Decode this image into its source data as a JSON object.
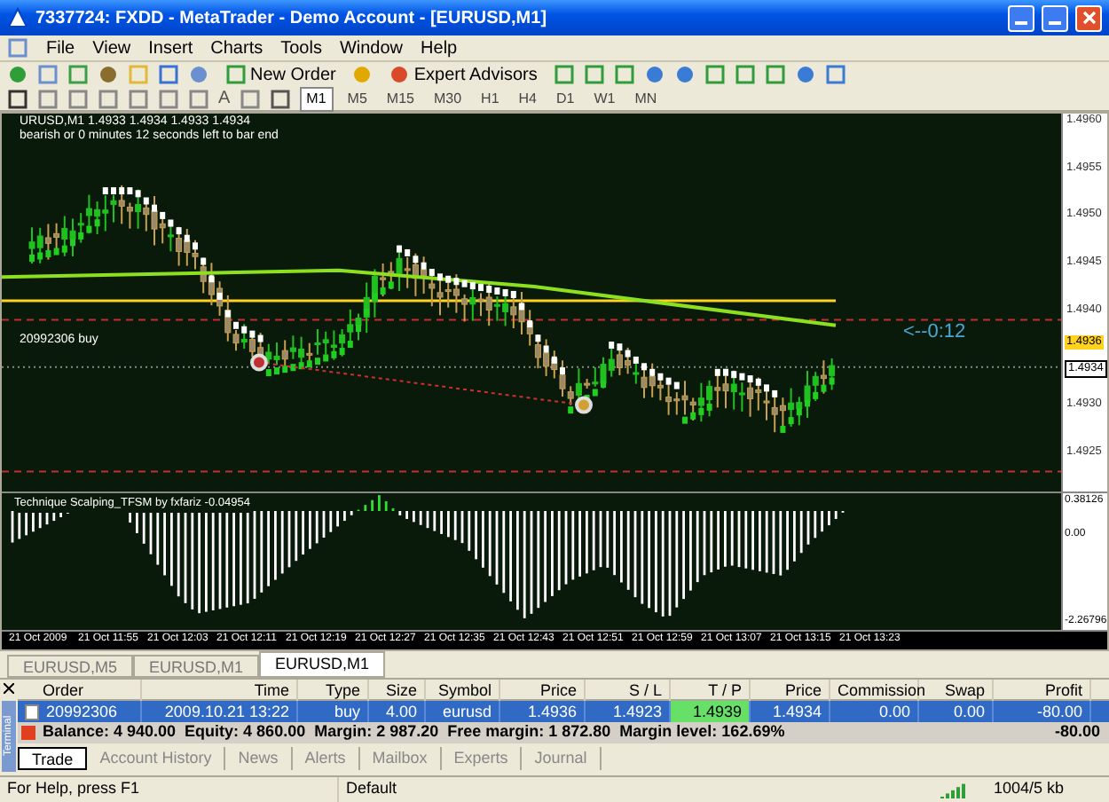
{
  "window": {
    "title": "7337724: FXDD - MetaTrader - Demo Account - [EURUSD,M1]"
  },
  "menu": [
    "File",
    "View",
    "Insert",
    "Charts",
    "Tools",
    "Window",
    "Help"
  ],
  "toolbar": {
    "new_order": "New Order",
    "expert_advisors": "Expert Advisors",
    "text_tool": "A"
  },
  "timeframes": [
    {
      "label": "M1",
      "selected": true
    },
    {
      "label": "M5",
      "selected": false
    },
    {
      "label": "M15",
      "selected": false
    },
    {
      "label": "M30",
      "selected": false
    },
    {
      "label": "H1",
      "selected": false
    },
    {
      "label": "H4",
      "selected": false
    },
    {
      "label": "D1",
      "selected": false
    },
    {
      "label": "W1",
      "selected": false
    },
    {
      "label": "MN",
      "selected": false
    }
  ],
  "chart": {
    "header": "URUSD,M1  1.4933 1.4934 1.4933 1.4934",
    "info": "bearish or 0 minutes 12 seconds left to bar end",
    "order_label": "20992306 buy",
    "countdown": "<--0:12",
    "price_axis": [
      {
        "label": "1.4960",
        "kind": "plain"
      },
      {
        "label": "1.4955",
        "kind": "plain"
      },
      {
        "label": "1.4950",
        "kind": "plain"
      },
      {
        "label": "1.4945",
        "kind": "plain"
      },
      {
        "label": "1.4940",
        "kind": "plain"
      },
      {
        "label": "1.4936",
        "kind": "ask"
      },
      {
        "label": "1.4934",
        "kind": "bid"
      },
      {
        "label": "1.4930",
        "kind": "plain"
      },
      {
        "label": "1.4925",
        "kind": "plain"
      }
    ],
    "indicator": {
      "title": "Technique Scalping_TFSM by fxfariz -0.04954",
      "axis": [
        "0.38126",
        "0.00",
        "-2.26796"
      ]
    },
    "time_axis": [
      "21 Oct 2009",
      "21 Oct 11:55",
      "21 Oct 12:03",
      "21 Oct 12:11",
      "21 Oct 12:19",
      "21 Oct 12:27",
      "21 Oct 12:35",
      "21 Oct 12:43",
      "21 Oct 12:51",
      "21 Oct 12:59",
      "21 Oct 13:07",
      "21 Oct 13:15",
      "21 Oct 13:23"
    ]
  },
  "chart_tabs": [
    {
      "label": "EURUSD,M5",
      "selected": false
    },
    {
      "label": "EURUSD,M1",
      "selected": false
    },
    {
      "label": "EURUSD,M1",
      "selected": true
    }
  ],
  "terminal": {
    "side_label": "Terminal",
    "columns": [
      "Order",
      "Time",
      "Type",
      "Size",
      "Symbol",
      "Price",
      "S / L",
      "T / P",
      "Price",
      "Commission",
      "Swap",
      "Profit"
    ],
    "rows": [
      {
        "selected": true,
        "cells": [
          "20992306",
          "2009.10.21 13:22",
          "buy",
          "4.00",
          "eurusd",
          "1.4936",
          "1.4923",
          "1.4939",
          "1.4934",
          "0.00",
          "0.00",
          "-80.00"
        ]
      }
    ],
    "summary": {
      "text": "Balance: 4 940.00  Equity: 4 860.00  Margin: 2 987.20  Free margin: 1 872.80  Margin level: 162.69%",
      "profit": "-80.00"
    },
    "tabs": [
      {
        "label": "Trade",
        "selected": true
      },
      {
        "label": "Account History",
        "selected": false
      },
      {
        "label": "News",
        "selected": false
      },
      {
        "label": "Alerts",
        "selected": false
      },
      {
        "label": "Mailbox",
        "selected": false
      },
      {
        "label": "Experts",
        "selected": false
      },
      {
        "label": "Journal",
        "selected": false
      }
    ]
  },
  "status_bar": {
    "help": "For Help, press F1",
    "profile": "Default",
    "traffic": "1004/5 kb"
  }
}
